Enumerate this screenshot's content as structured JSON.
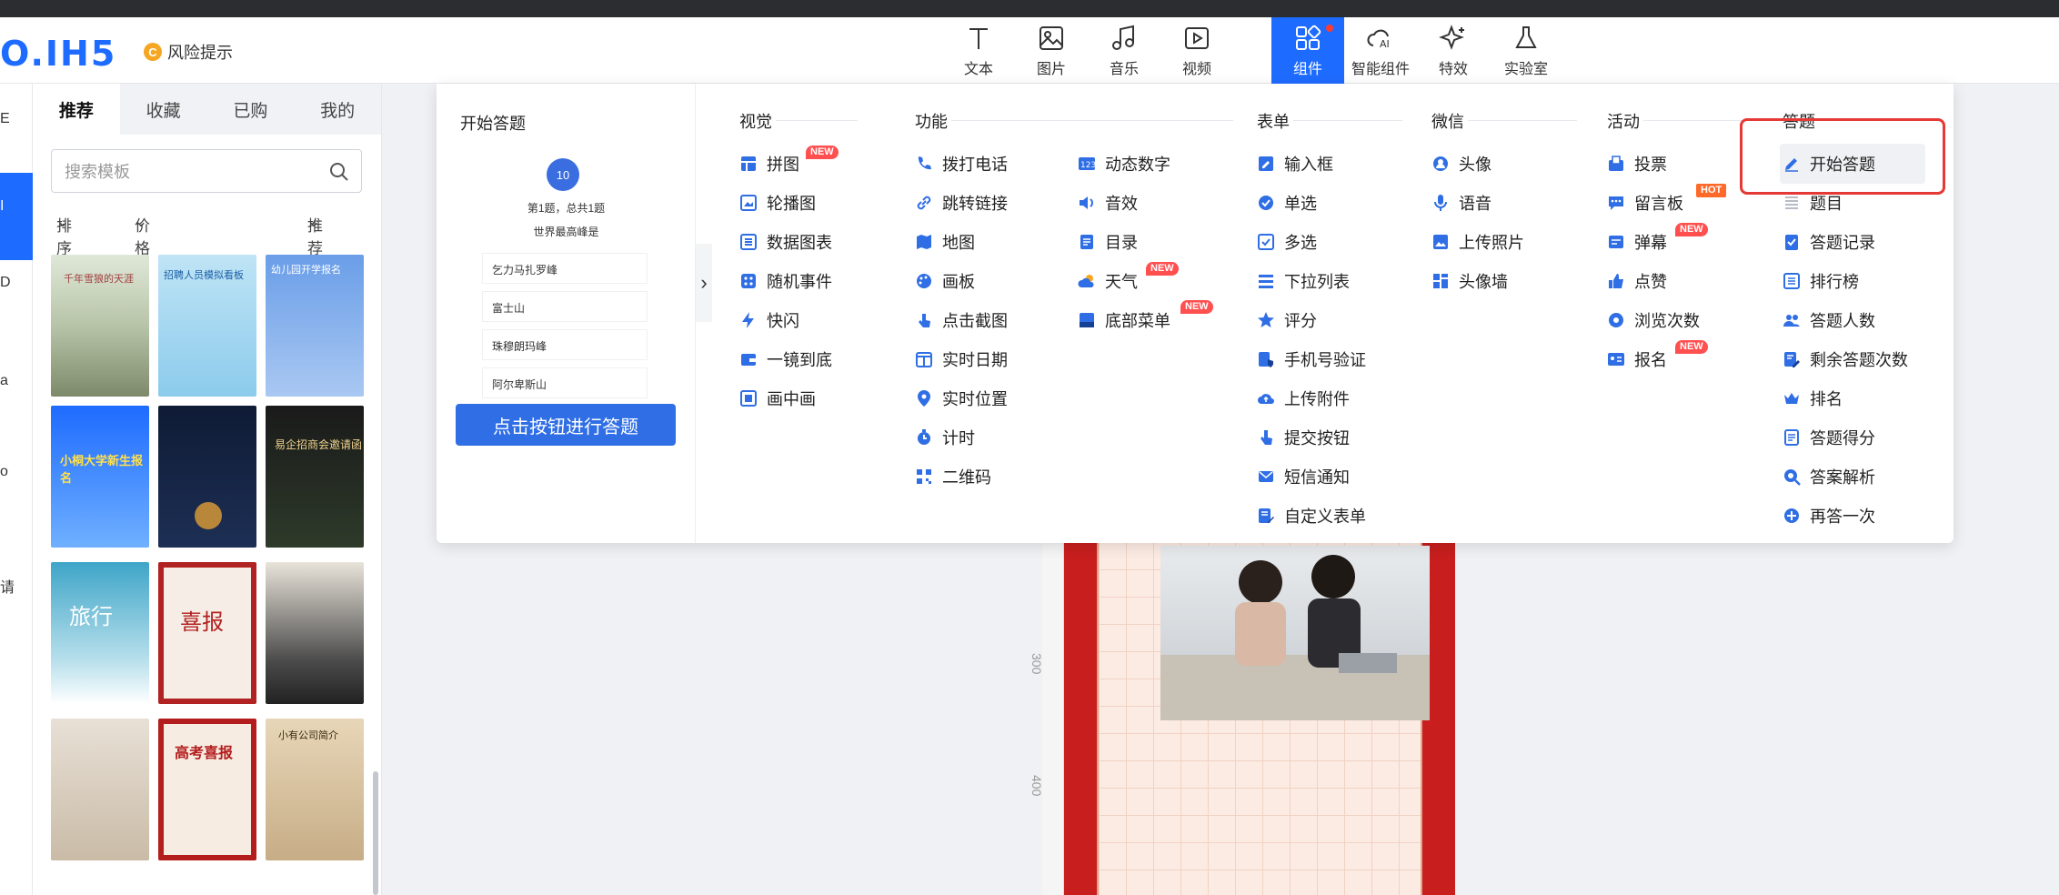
{
  "header": {
    "logo": "O.IH5",
    "risk_label": "风险提示",
    "risk_badge": "C",
    "tools": [
      "文本",
      "图片",
      "音乐",
      "视频",
      "组件",
      "智能组件",
      "特效",
      "实验室"
    ]
  },
  "sidebar": {
    "tabs": [
      "推荐",
      "收藏",
      "已购",
      "我的"
    ],
    "search_placeholder": "搜索模板",
    "filters": {
      "sort": "排序",
      "price": "价格",
      "recommend": "推荐"
    },
    "thumbnails": [
      "千年雪狼的天涯",
      "招聘人员模拟看板",
      "幼儿园开学报名",
      "小桐大学新生报名",
      "",
      "易企招商会邀请函",
      "旅行",
      "喜报",
      "",
      "",
      "高考喜报",
      "小有公司简介"
    ]
  },
  "panel": {
    "preview": {
      "title": "开始答题",
      "circle": "10",
      "question_index": "第1题，总共1题",
      "question": "世界最高峰是",
      "options": [
        "乞力马扎罗峰",
        "富士山",
        "珠穆朗玛峰",
        "阿尔卑斯山"
      ],
      "start_button": "点击按钮进行答题"
    },
    "columns": {
      "visual": {
        "title": "视觉",
        "items": [
          "拼图",
          "轮播图",
          "数据图表",
          "随机事件",
          "快闪",
          "一镜到底",
          "画中画"
        ]
      },
      "function": {
        "title": "功能",
        "items_a": [
          "拨打电话",
          "跳转链接",
          "地图",
          "画板",
          "点击截图",
          "实时日期",
          "实时位置",
          "计时",
          "二维码"
        ],
        "items_b": [
          "动态数字",
          "音效",
          "目录",
          "天气",
          "底部菜单"
        ]
      },
      "form": {
        "title": "表单",
        "items": [
          "输入框",
          "单选",
          "多选",
          "下拉列表",
          "评分",
          "手机号验证",
          "上传附件",
          "提交按钮",
          "短信通知",
          "自定义表单"
        ]
      },
      "wechat": {
        "title": "微信",
        "items": [
          "头像",
          "语音",
          "上传照片",
          "头像墙"
        ]
      },
      "activity": {
        "title": "活动",
        "items": [
          "投票",
          "留言板",
          "弹幕",
          "点赞",
          "浏览次数",
          "报名"
        ]
      },
      "quiz": {
        "title": "答题",
        "items": [
          "开始答题",
          "题目",
          "答题记录",
          "排行榜",
          "答题人数",
          "剩余答题次数",
          "排名",
          "答题得分",
          "答案解析",
          "再答一次"
        ]
      }
    },
    "tags": {
      "new": "NEW",
      "hot": "HOT"
    }
  },
  "ruler": [
    "300",
    "400"
  ],
  "left_strip": [
    "E",
    "I",
    "D",
    "a",
    "o",
    "请"
  ],
  "colors": {
    "accent": "#1e6bff",
    "new_tag": "#ff4f4f",
    "highlight": "#e53935"
  }
}
